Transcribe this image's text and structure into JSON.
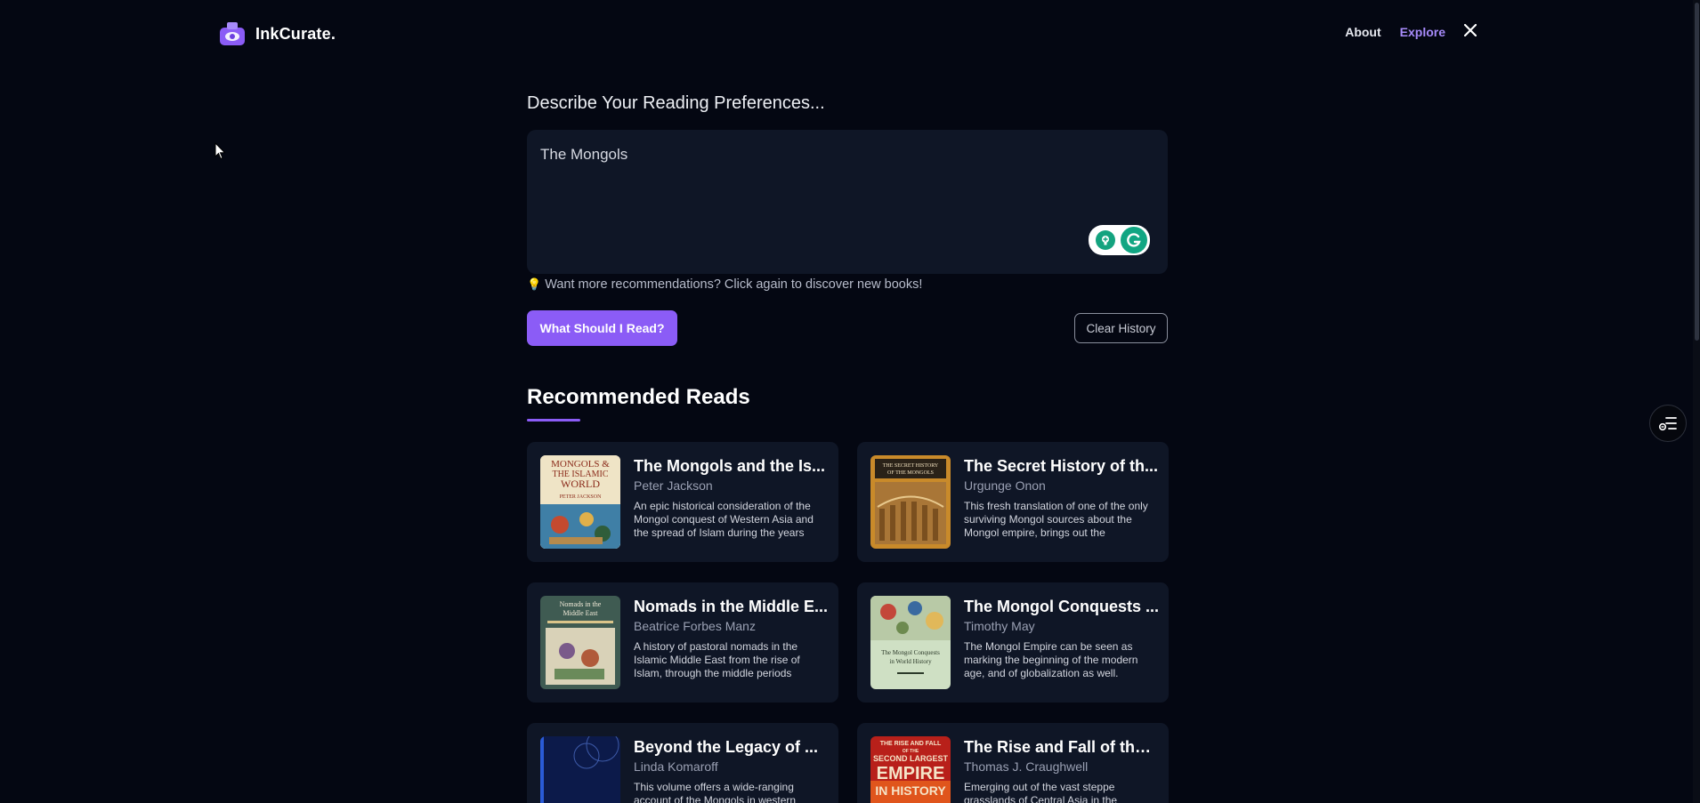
{
  "header": {
    "brand": "InkCurate.",
    "nav": {
      "about": "About",
      "explore": "Explore",
      "x": "X"
    }
  },
  "prompt": {
    "title": "Describe Your Reading Preferences...",
    "value": "The Mongols",
    "hint": "Want more recommendations? Click again to discover new books!"
  },
  "actions": {
    "primary": "What Should I Read?",
    "clear": "Clear History"
  },
  "recommendations": {
    "title": "Recommended Reads",
    "books": [
      {
        "title": "The Mongols and the Is...",
        "author": "Peter Jackson",
        "description": "An epic historical consideration of the Mongol conquest of Western Asia and the spread of Islam during the years",
        "cover_text": [
          "MONGOLS &",
          "THE ISLAMIC",
          "WORLD",
          "PETER JACKSON"
        ]
      },
      {
        "title": "The Secret History of th...",
        "author": "Urgunge Onon",
        "description": "This fresh translation of one of the only surviving Mongol sources about the Mongol empire, brings out the",
        "cover_text": [
          "THE SECRET HISTORY",
          "OF THE MONGOLS"
        ]
      },
      {
        "title": "Nomads in the Middle E...",
        "author": "Beatrice Forbes Manz",
        "description": "A history of pastoral nomads in the Islamic Middle East from the rise of Islam, through the middle periods",
        "cover_text": [
          "Nomads in the",
          "Middle East"
        ]
      },
      {
        "title": "The Mongol Conquests ...",
        "author": "Timothy May",
        "description": "The Mongol Empire can be seen as marking the beginning of the modern age, and of globalization as well.",
        "cover_text": [
          "The Mongol Conquests",
          "in World History"
        ]
      },
      {
        "title": "Beyond the Legacy of ...",
        "author": "Linda Komaroff",
        "description": "This volume offers a wide-ranging account of the Mongols in western",
        "cover_text": []
      },
      {
        "title": "The Rise and Fall of the ...",
        "author": "Thomas J. Craughwell",
        "description": "Emerging out of the vast steppe grasslands of Central Asia in the",
        "cover_text": [
          "THE RISE AND FALL",
          "OF THE",
          "SECOND LARGEST",
          "EMPIRE",
          "IN HISTORY"
        ]
      }
    ]
  },
  "colors": {
    "background": "#040712",
    "surface": "#0f1626",
    "accent": "#8b5cf6",
    "accent_light": "#a78bfa"
  }
}
